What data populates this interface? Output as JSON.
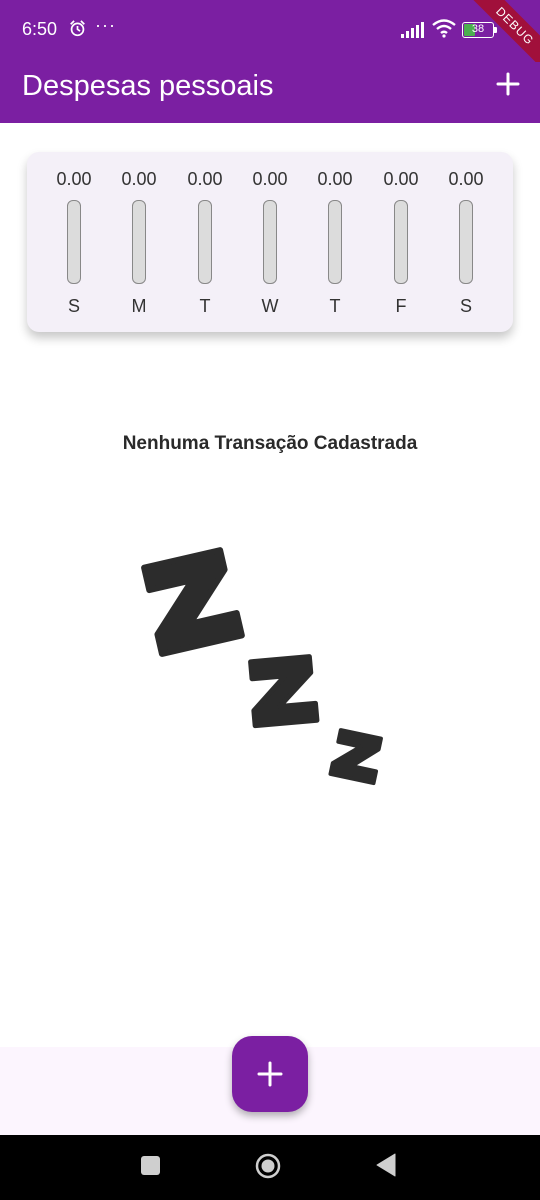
{
  "status_bar": {
    "time": "6:50",
    "more": "···",
    "battery": "38"
  },
  "debug_banner": "DEBUG",
  "app_bar": {
    "title": "Despesas pessoais",
    "add_icon": "plus-icon"
  },
  "chart": {
    "days": [
      {
        "label": "S",
        "value": "0.00",
        "fraction": 0
      },
      {
        "label": "M",
        "value": "0.00",
        "fraction": 0
      },
      {
        "label": "T",
        "value": "0.00",
        "fraction": 0
      },
      {
        "label": "W",
        "value": "0.00",
        "fraction": 0
      },
      {
        "label": "T",
        "value": "0.00",
        "fraction": 0
      },
      {
        "label": "F",
        "value": "0.00",
        "fraction": 0
      },
      {
        "label": "S",
        "value": "0.00",
        "fraction": 0
      }
    ]
  },
  "empty_state": {
    "message": "Nenhuma Transação Cadastrada",
    "image_icon": "zzz-sleep-icon"
  },
  "fab": {
    "icon": "plus-icon"
  },
  "colors": {
    "primary": "#7b1fa2",
    "card": "#f4f0f8",
    "bar_track": "#dcdcdc"
  }
}
